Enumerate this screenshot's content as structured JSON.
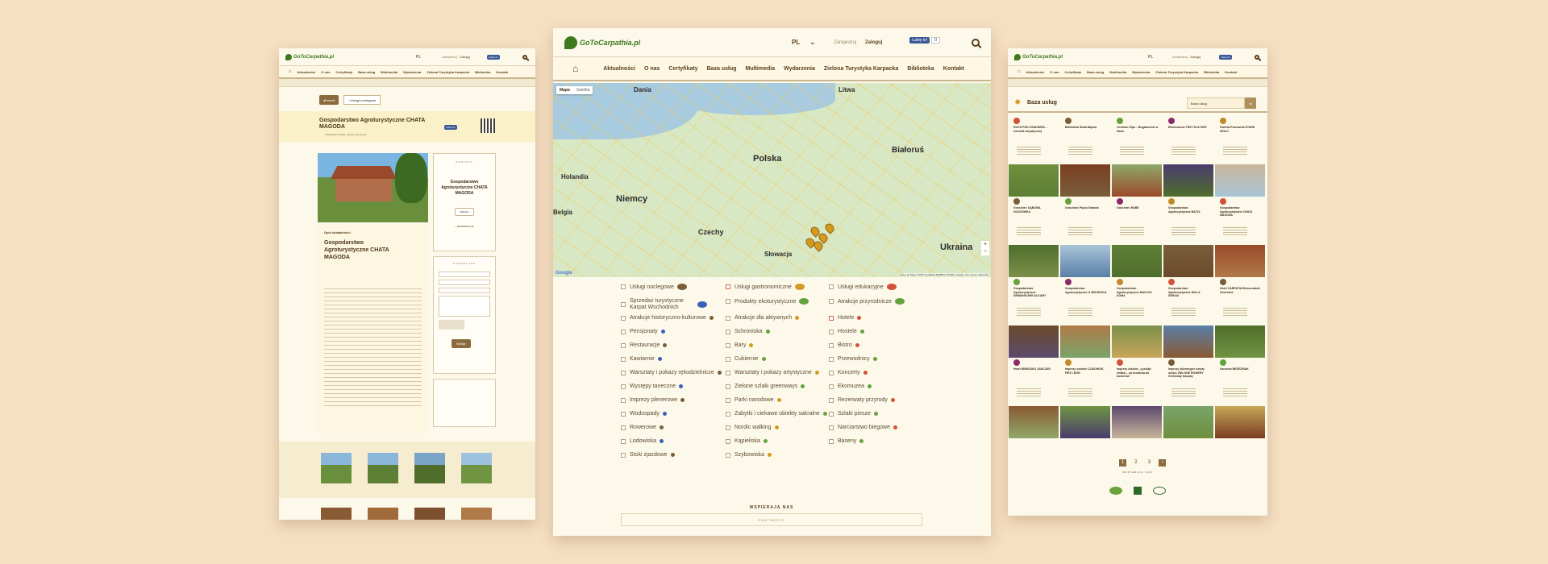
{
  "site": {
    "name": "GoToCarpathia.pl",
    "search_placeholder": ""
  },
  "left": {
    "lang": "PL",
    "login": "Zaloguj",
    "register": "Zarejestruj",
    "fb_like": "Lubię to!",
    "nav": [
      "Aktualności",
      "O nas",
      "Certyfikaty",
      "Baza usług",
      "Multimedia",
      "Wydarzenia",
      "Zielona Turystyka Karpacka",
      "Biblioteka",
      "Kontakt"
    ],
    "back": "Powrót",
    "services": "Usługi noclegowe",
    "title": "Gospodarstwo Agroturystyczne CHATA MAGODA",
    "address": "Lubatówka, Polska, Krosno, Rymanów",
    "contact_header": "KONTAKT",
    "contact_title": "Gospodarstwo Agroturystyczne CHATA MAGODA",
    "contact_btn": "WIĘCEJ",
    "rezerwacje": "+ REZERWACJE",
    "form_header": "FORMULARZ",
    "send": "Wyślij",
    "desc_label": "Opis działalności",
    "desc_title": "Gospodarstwo Agroturystyczne CHATA MAGODA"
  },
  "center": {
    "lang": "PL",
    "register": "Zarejestruj",
    "login": "Zaloguj",
    "fb_like": "Lubię to!",
    "fb_count": "0",
    "nav": [
      "Aktualności",
      "O nas",
      "Certyfikaty",
      "Baza usług",
      "Multimedia",
      "Wydarzenia",
      "Zielona Turystyka Karpacka",
      "Biblioteka",
      "Kontakt"
    ],
    "map_type": [
      "Mapa",
      "Satelita"
    ],
    "map_labels": {
      "dania": "Dania",
      "litwa": "Litwa",
      "holandia": "Holandia",
      "polska": "Polska",
      "bialorus": "Białoruś",
      "niemcy": "Niemcy",
      "czechy": "Czechy",
      "slowacja": "Słowacja",
      "ukraina": "Ukraina",
      "belgia": "Belgia",
      "google": "Google"
    },
    "map_attribution": "Dane do Mapy ©2015 GeoBasis-DE/BKG (©2009), Google, Inst. Geogr. Nacional",
    "legend": [
      [
        "Usługi noclegowe",
        "Usługi gastronomiczne",
        "Usługi edukacyjne"
      ],
      [
        "Sprzedaż turystyczne Karpat Wschodnich",
        "Produkty ekoturystyczne",
        "Atrakcje przyrodnicze"
      ],
      [
        "Atrakcje historyczno-kulturowe",
        "Atrakcje dla aktywnych",
        "Hotele"
      ],
      [
        "Pensjonaty",
        "Schroniska",
        "Hostele"
      ],
      [
        "Restauracje",
        "Bary",
        "Bistro"
      ],
      [
        "Kawiarnie",
        "Cukiernie",
        "Przewodnicy"
      ],
      [
        "Warsztaty i pokazy rękodzielnicze",
        "Warsztaty i pokazy artystyczne",
        "Koncerty"
      ],
      [
        "Występy taneczne",
        "Zielone szlaki greenways",
        "Ekomuzea"
      ],
      [
        "Imprezy plenerowe",
        "Parki narodowe",
        "Rezerwaty przyrody"
      ],
      [
        "Wodospady",
        "Zabytki i ciekawe obiekty sakralne",
        "Szlaki piesze"
      ],
      [
        "Rowerowe",
        "Nordic walking",
        "Narciarstwo biegowe"
      ],
      [
        "Lodowiska",
        "Kąpieliska",
        "Baseny"
      ],
      [
        "Stoki zjazdowe",
        "Szybowiska",
        ""
      ]
    ],
    "supporters": "WSPIERAJĄ NAS",
    "partners": "PARTNERZY"
  },
  "right": {
    "lang": "PL",
    "register": "Zarejestruj",
    "login": "Zaloguj",
    "fb_like": "Lubię to!",
    "nav": [
      "Aktualności",
      "O nas",
      "Certyfikaty",
      "Baza usług",
      "Multimedia",
      "Wydarzenia",
      "Zielona Turystyka Karpacka",
      "Biblioteka",
      "Kontakt"
    ],
    "section_title": "Baza usług",
    "filter": "Baza usług",
    "rows": [
      [
        "DUCH POD OSADKIEM – ośrodek turystycznej",
        "Biblioteka Świat Bajeka",
        "Centrum Hipo – Bogatecznie w Sanie",
        "Ekomuzeum TRZY KULTURY",
        "Galeria-Pracownia STARE SIOŁO"
      ],
      [
        "Gościniec DĄBOWA DOZGÓWKA",
        "Gościniec Pięciu Stawów",
        "Gościniec RABE",
        "Gospodarstwo Agroturystyczne BAZYL",
        "Gospodarstwo Agroturystyczne CHATA MAGODA"
      ],
      [
        "Gospodarstwo Agroturystyczne DEMIANKOWE ALKAMY",
        "Gospodarstwo Agroturystyczne U ZBOJECKA",
        "Gospodarstwo Agroturystyczne MACCZA DOMA",
        "Gospodarstwo Agroturystyczne WILLA SERAIA",
        "Hotel CARPATIA Bieszczadzki Gościniec"
      ],
      [
        "Hotel NIEBUSKO JANCZAR",
        "Imprezy szkolne CZAIOWOK, PIES i BOR",
        "Imprezy szkolne „Łysiejki chałka – od krowicka do kocherka”",
        "Imprezy skieracyjne szkoły miejsc ZIELONE ROWERY Greenway Karpaty",
        "Karczma BRZEZINAK"
      ]
    ],
    "pages": [
      "1",
      "2",
      "3"
    ],
    "supporters": "WSPIERAJĄ NAS"
  },
  "colors": {
    "brand_green": "#3d7a1e",
    "brown": "#8b6b3e",
    "bg": "#f6dfc2",
    "panel": "#fdf9ea"
  }
}
